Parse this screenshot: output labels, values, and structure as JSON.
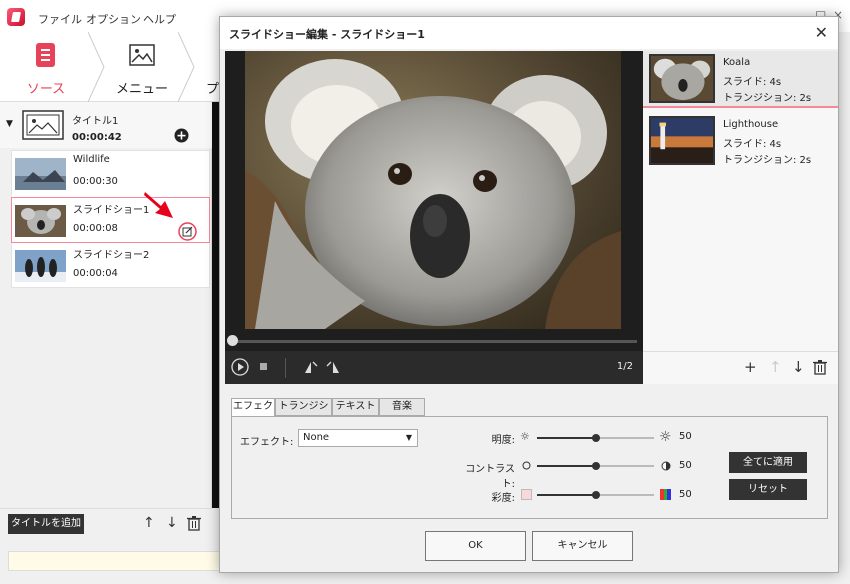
{
  "menu": {
    "file": "ファイル",
    "options": "オプション",
    "help": "ヘルプ"
  },
  "window_controls": {
    "restore": "□",
    "close": "×"
  },
  "steps": {
    "source": "ソース",
    "menu": "メニュー",
    "preview_partial": "プ"
  },
  "title_item": {
    "name": "タイトル1",
    "duration": "00:00:42"
  },
  "clips": [
    {
      "name": "Wildlife",
      "duration": "00:00:30"
    },
    {
      "name": "スライドショー1",
      "duration": "00:00:08"
    },
    {
      "name": "スライドショー2",
      "duration": "00:00:04"
    }
  ],
  "bottom_bar": {
    "add_title": "タイトルを追加"
  },
  "dialog": {
    "title": "スライドショー編集 - スライドショー1",
    "page_indicator": "1/2",
    "slides": [
      {
        "name": "Koala",
        "slide": "スライド: 4s",
        "transition": "トランジション: 2s"
      },
      {
        "name": "Lighthouse",
        "slide": "スライド: 4s",
        "transition": "トランジション: 2s"
      }
    ],
    "tabs": [
      "エフェクト",
      "トランジション",
      "テキスト",
      "音楽"
    ],
    "effect_label": "エフェクト:",
    "effect_value": "None",
    "sliders": [
      {
        "label": "明度:",
        "value": "50",
        "level": 0.5
      },
      {
        "label": "コントラスト:",
        "value": "50",
        "level": 0.5
      },
      {
        "label": "彩度:",
        "value": "50",
        "level": 0.5
      }
    ],
    "apply_all": "全てに適用",
    "reset": "リセット",
    "ok": "OK",
    "cancel": "キャンセル"
  },
  "colors": {
    "accent": "#e8415a",
    "selection_border": "#f4899b"
  }
}
